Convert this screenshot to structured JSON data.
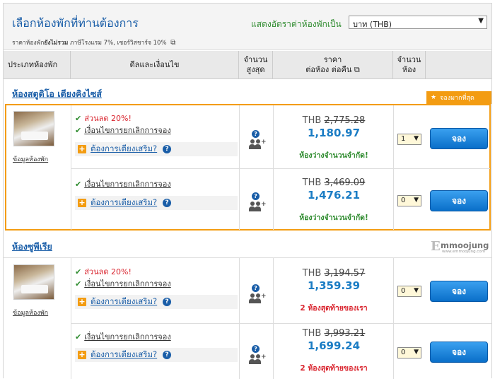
{
  "header": {
    "title": "เลือกห้องพักที่ท่านต้องการ",
    "currency_label": "แสดงอัตราค่าห้องพักเป็น",
    "currency_value": "บาท (THB)",
    "note_prefix": "ราคาห้องพัก",
    "note_bold": "ยังไม่รวม",
    "note_suffix": " ภาษีโรงแรม 7%, เซอร์วิสชาร์จ 10%"
  },
  "columns": {
    "room_type": "ประเภทห้องพัก",
    "conditions": "ดีลและเงื่อนไข",
    "max_line1": "จำนวน",
    "max_line2": "สูงสุด",
    "price_line1": "ราคา",
    "price_line2": "ต่อห้อง ต่อคืน",
    "rooms_line1": "จำนวน",
    "rooms_line2": "ห้อง"
  },
  "badge": {
    "label": "จองมากที่สุด",
    "color": "#f39c12"
  },
  "watermark": {
    "brand": "mmoojung",
    "url": "www.emmoojung.com"
  },
  "rooms": [
    {
      "title": "ห้องสตูดิโอ เตียงคิงไซส์",
      "info_link": "ข้อมูลห้องพัก",
      "offers": [
        {
          "discount": "ส่วนลด 20%!",
          "cancel": "เงื่อนไขการยกเลิกการจอง",
          "extra": "ต้องการเตียงเสริม?",
          "currency": "THB",
          "old_price": "2,775.28",
          "new_price": "1,180.97",
          "availability": "ห้องว่างจำนวนจำกัด!",
          "qty": "1",
          "book": "จอง"
        },
        {
          "cancel": "เงื่อนไขการยกเลิกการจอง",
          "extra": "ต้องการเตียงเสริม?",
          "currency": "THB",
          "old_price": "3,469.09",
          "new_price": "1,476.21",
          "availability": "ห้องว่างจำนวนจำกัด!",
          "qty": "0",
          "book": "จอง"
        }
      ]
    },
    {
      "title": "ห้องซูพีเรีย",
      "info_link": "ข้อมูลห้องพัก",
      "offers": [
        {
          "discount": "ส่วนลด 20%!",
          "cancel": "เงื่อนไขการยกเลิกการจอง",
          "extra": "ต้องการเตียงเสริม?",
          "currency": "THB",
          "old_price": "3,194.57",
          "new_price": "1,359.39",
          "availability": "2 ห้องสุดท้ายของเรา",
          "qty": "0",
          "book": "จอง"
        },
        {
          "cancel": "เงื่อนไขการยกเลิกการจอง",
          "extra": "ต้องการเตียงเสริม?",
          "currency": "THB",
          "old_price": "3,993.21",
          "new_price": "1,699.24",
          "availability": "2 ห้องสุดท้ายของเรา",
          "qty": "0",
          "book": "จอง"
        }
      ]
    }
  ]
}
